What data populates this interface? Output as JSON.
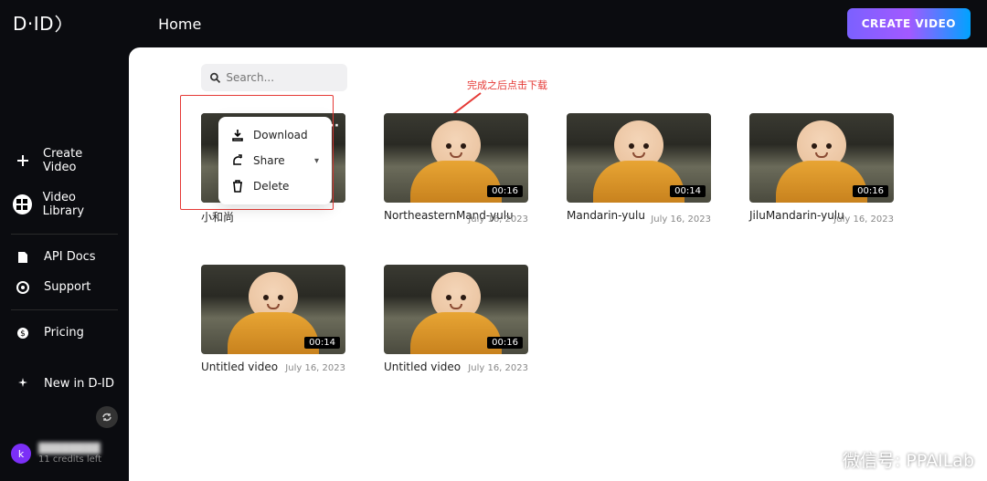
{
  "header": {
    "logo": "D·ID",
    "title": "Home",
    "create_button": "CREATE VIDEO"
  },
  "sidebar": {
    "items": [
      {
        "label": "Create Video",
        "icon": "plus-icon"
      },
      {
        "label": "Video Library",
        "icon": "grid-icon"
      },
      {
        "label": "API Docs",
        "icon": "doc-icon"
      },
      {
        "label": "Support",
        "icon": "help-icon"
      },
      {
        "label": "Pricing",
        "icon": "dollar-icon"
      }
    ],
    "new_label": "New in D-ID",
    "user_initial": "k",
    "credits": "11 credits left"
  },
  "search": {
    "placeholder": "Search..."
  },
  "annotation": "完成之后点击下载",
  "menu": {
    "download": "Download",
    "share": "Share",
    "delete": "Delete"
  },
  "cards": [
    {
      "title": "小和尚",
      "date": "",
      "duration": ""
    },
    {
      "title": "NortheasternMand-yulu",
      "date": "July 16, 2023",
      "duration": "00:16"
    },
    {
      "title": "Mandarin-yulu",
      "date": "July 16, 2023",
      "duration": "00:14"
    },
    {
      "title": "JiluMandarin-yulu",
      "date": "July 16, 2023",
      "duration": "00:16"
    },
    {
      "title": "Untitled video",
      "date": "July 16, 2023",
      "duration": "00:14"
    },
    {
      "title": "Untitled video",
      "date": "July 16, 2023",
      "duration": "00:16"
    }
  ],
  "watermark": "微信号: PPAILab"
}
